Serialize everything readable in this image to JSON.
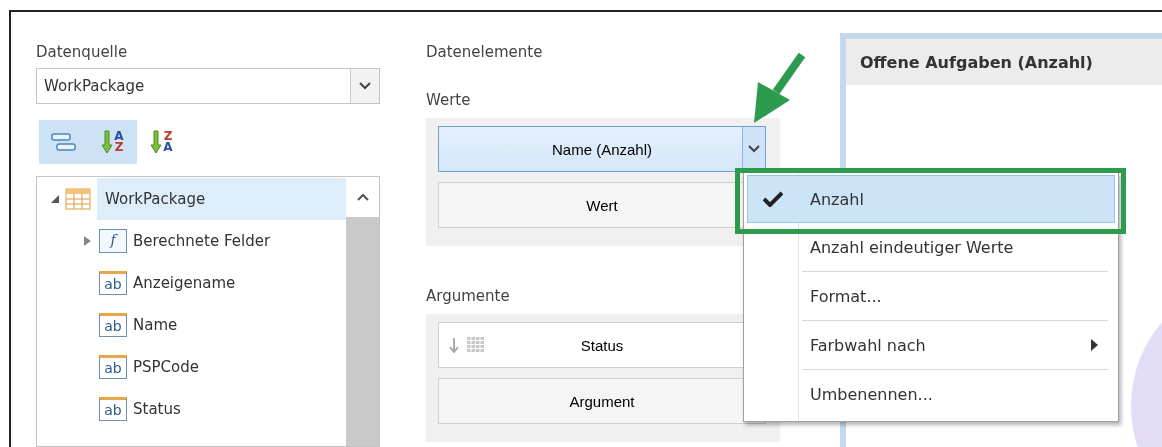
{
  "data_source": {
    "label": "Datenquelle",
    "value": "WorkPackage"
  },
  "toolbar": [
    {
      "kind": "group",
      "selected": true
    },
    {
      "kind": "sort",
      "selected": true,
      "letters": [
        {
          "text": "A",
          "color": "#2b4fa8"
        },
        {
          "text": "Z",
          "color": "#c0392b"
        }
      ]
    },
    {
      "kind": "sort",
      "selected": false,
      "letters": [
        {
          "text": "Z",
          "color": "#c0392b"
        },
        {
          "text": "A",
          "color": "#2b4fa8"
        }
      ]
    }
  ],
  "tree": {
    "label": "WorkPackage",
    "expanded": true,
    "selected": true,
    "children": [
      {
        "label": "Berechnete Felder",
        "kind": "calculated",
        "icon_text": "f",
        "expanded": false
      },
      {
        "label": "Anzeigename",
        "kind": "text",
        "icon_text": "ab"
      },
      {
        "label": "Name",
        "kind": "text",
        "icon_text": "ab"
      },
      {
        "label": "PSPCode",
        "kind": "text",
        "icon_text": "ab"
      },
      {
        "label": "Status",
        "kind": "text",
        "icon_text": "ab"
      }
    ]
  },
  "data_items": {
    "title": "Datenelemente",
    "values": {
      "label": "Werte",
      "items": [
        {
          "label": "Name (Anzahl)",
          "kind": "measure",
          "selected": true
        },
        {
          "label": "Wert",
          "kind": "placeholder",
          "selected": false
        }
      ]
    },
    "arguments": {
      "label": "Argumente",
      "items": [
        {
          "label": "Status",
          "kind": "dimension"
        },
        {
          "label": "Argument",
          "kind": "placeholder"
        }
      ]
    }
  },
  "context_menu": {
    "items": [
      {
        "label": "Anzahl",
        "checked": true,
        "selected": true,
        "submenu": false,
        "separator_before": false
      },
      {
        "label": "Anzahl eindeutiger Werte",
        "checked": false,
        "selected": false,
        "submenu": false,
        "separator_before": false
      },
      {
        "label": "Format...",
        "checked": false,
        "selected": false,
        "submenu": false,
        "separator_before": true
      },
      {
        "label": "Farbwahl nach",
        "checked": false,
        "selected": false,
        "submenu": true,
        "separator_before": true
      },
      {
        "label": "Umbenennen...",
        "checked": false,
        "selected": false,
        "submenu": false,
        "separator_before": true
      }
    ]
  },
  "chart_panel": {
    "title": "Offene Aufgaben (Anzahl)"
  }
}
